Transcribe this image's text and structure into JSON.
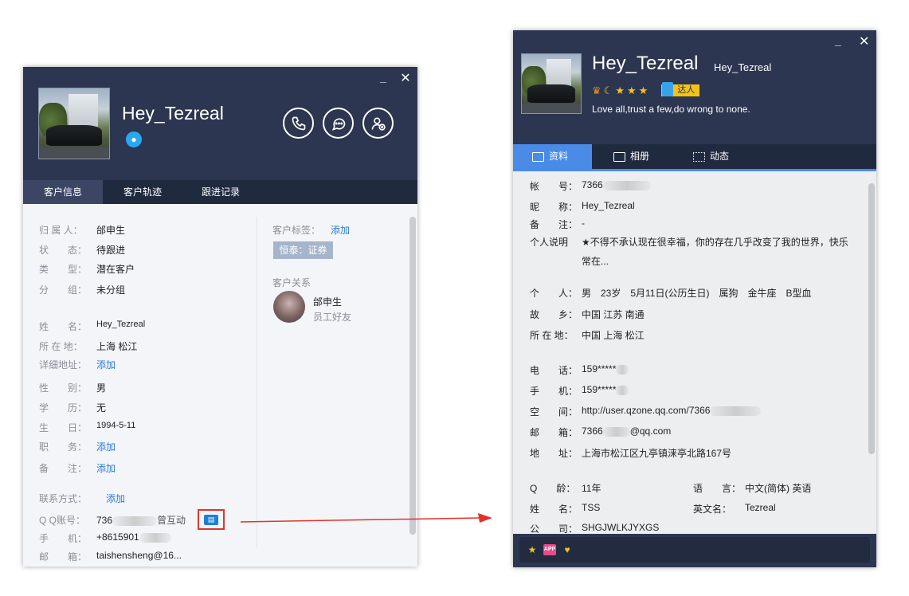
{
  "left": {
    "name": "Hey_Tezreal",
    "qq_icon": "penguin-icon",
    "window": {
      "min": "_",
      "close": "✕"
    },
    "tabs": [
      "客户信息",
      "客户轨迹",
      "跟进记录"
    ],
    "fields": [
      {
        "label": "归 属 人：",
        "value": "邰申生"
      },
      {
        "label": "状　　态：",
        "value": "待跟进"
      },
      {
        "label": "类　　型：",
        "value": "潜在客户"
      },
      {
        "label": "分　　组：",
        "value": "未分组"
      },
      {
        "label": "姓　　名：",
        "value": "Hey_Tezreal"
      },
      {
        "label": "所 在 地：",
        "value": "上海 松江"
      },
      {
        "label": "详细地址：",
        "value": "添加"
      },
      {
        "label": "性　　别：",
        "value": "男"
      },
      {
        "label": "学　　历：",
        "value": "无"
      },
      {
        "label": "生　　日：",
        "value": "1994-5-11"
      },
      {
        "label": "职　　务：",
        "value": "添加"
      },
      {
        "label": "备　　注：",
        "value": "添加"
      }
    ],
    "contact": {
      "title": "联系方式：",
      "add": "添加",
      "qq_label": "Q Q账号：",
      "qq_prefix": "736",
      "qq_suffix": "曾互动",
      "phone_label": "手　　机：",
      "phone": "+8615901",
      "email_label": "邮　　箱：",
      "email": "taishensheng@16..."
    },
    "tags": {
      "label": "客户标签：",
      "add": "添加",
      "tag": "恒泰：证券"
    },
    "relation": {
      "label": "客户关系",
      "name": "邰申生",
      "desc": "员工好友"
    }
  },
  "right": {
    "name": "Hey_Tezreal",
    "nick": "Hey_Tezreal",
    "window": {
      "min": "_",
      "close": "✕"
    },
    "badges": [
      "♛",
      "☾",
      "★",
      "★",
      "★"
    ],
    "daren": "达人",
    "signature": "Love all,trust a few,do wrong to none.",
    "tabs": [
      "资料",
      "相册",
      "动态"
    ],
    "rows": [
      {
        "label": "帐　　号：",
        "value": "7366"
      },
      {
        "label": "昵　　称：",
        "value": "Hey_Tezreal"
      },
      {
        "label": "备　　注：",
        "value": "-"
      },
      {
        "label": "个人说明",
        "value": "★不得不承认现在很幸福，你的存在几乎改变了我的世界，快乐"
      },
      {
        "label": "",
        "value": "常在..."
      },
      {
        "label": "个　　人：",
        "value": "男　23岁　5月11日(公历生日)　属狗　金牛座　B型血"
      },
      {
        "label": "故　　乡：",
        "value": "中国 江苏 南通"
      },
      {
        "label": "所 在 地：",
        "value": "中国 上海 松江"
      },
      {
        "label": "电　　话：",
        "value": "159*****"
      },
      {
        "label": "手　　机：",
        "value": "159*****"
      },
      {
        "label": "空　　间：",
        "value": "http://user.qzone.qq.com/7366"
      },
      {
        "label": "邮　　箱：",
        "value": "7366",
        "value2": "@qq.com"
      },
      {
        "label": "地　　址：",
        "value": "上海市松江区九亭镇涞亭北路167号"
      }
    ],
    "grid": [
      {
        "label": "Q　　龄：",
        "value": "11年",
        "label2": "语　　言：",
        "value2": "中文(简体)  英语"
      },
      {
        "label": "姓　　名：",
        "value": "TSS",
        "label2": "英文名：",
        "value2": "Tezreal"
      },
      {
        "label": "公　　司：",
        "value": "SHGJWLKJYXGS"
      }
    ],
    "footer_icons": [
      "star-icon",
      "app-icon",
      "vip-icon"
    ],
    "footer_app": "APP"
  },
  "colors": {
    "header": "#2c3650",
    "tabbar": "#202a3f",
    "accent": "#4a8be8",
    "link": "#2a7ad8",
    "highlight": "#e2332b"
  }
}
